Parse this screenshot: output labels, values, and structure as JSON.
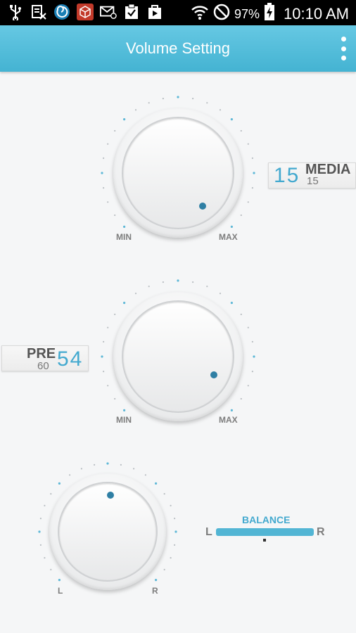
{
  "status_bar": {
    "icons": [
      "usb-icon",
      "storage-icon",
      "shell-app-icon",
      "cube-app-icon",
      "mail-icon",
      "clipboard-check-icon",
      "play-store-icon"
    ],
    "battery_percent": "97%",
    "time": "10:10 AM"
  },
  "app_bar": {
    "title": "Volume Setting"
  },
  "media_knob": {
    "min_label": "MIN",
    "max_label": "MAX"
  },
  "media_readout": {
    "value": "15",
    "name": "MEDIA",
    "sub_value": "15"
  },
  "pre_knob": {
    "min_label": "MIN",
    "max_label": "MAX"
  },
  "pre_readout": {
    "name": "PRE",
    "sub_value": "60",
    "value": "54"
  },
  "balance_knob": {
    "left_label": "L",
    "right_label": "R"
  },
  "balance": {
    "title": "BALANCE",
    "left": "L",
    "right": "R"
  },
  "colors": {
    "accent": "#43a9cf",
    "appbar": "#55bedb",
    "dot": "#2f7fa4"
  }
}
